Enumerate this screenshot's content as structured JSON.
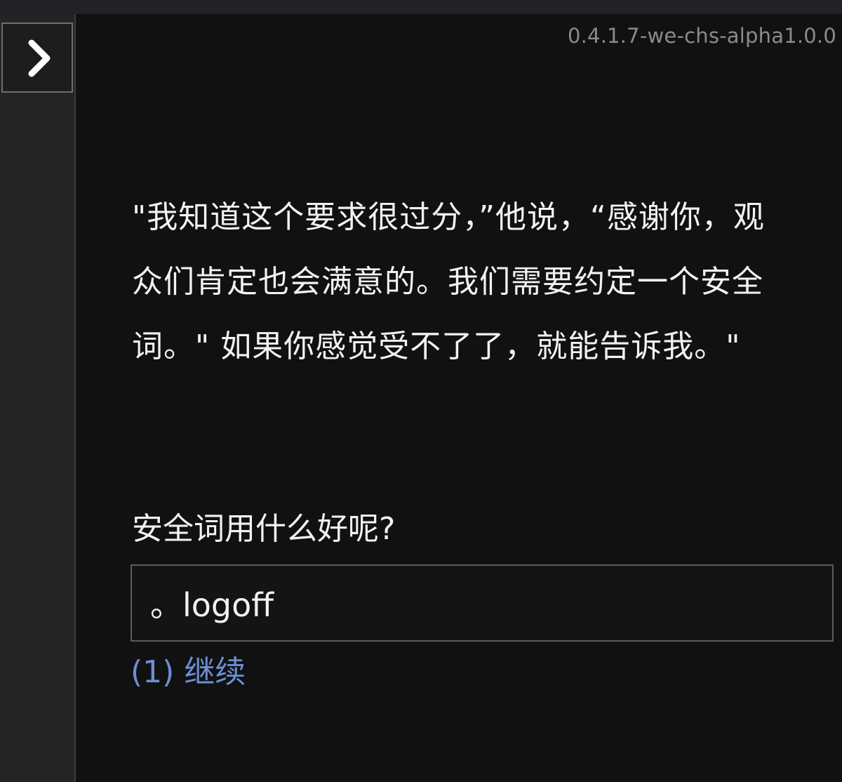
{
  "header": {
    "version": "0.4.1.7-we-chs-alpha1.0.0"
  },
  "sidebar": {
    "toggle_icon": "chevron-right-icon"
  },
  "story": {
    "passage": "\"我知道这个要求很过分，”他说，“感谢你，观众们肯定也会满意的。我们需要约定一个安全词。\" 如果你感觉受不了了，就能告诉我。\"",
    "prompt": "安全词用什么好呢?",
    "answer_value": "。logoff",
    "continue_label": "(1) 继续"
  },
  "colors": {
    "background": "#111111",
    "sidebar": "#242424",
    "text": "#f2f2f2",
    "muted": "#8b8b8b",
    "link": "#6c8fd4",
    "border": "#5b5b5b"
  }
}
